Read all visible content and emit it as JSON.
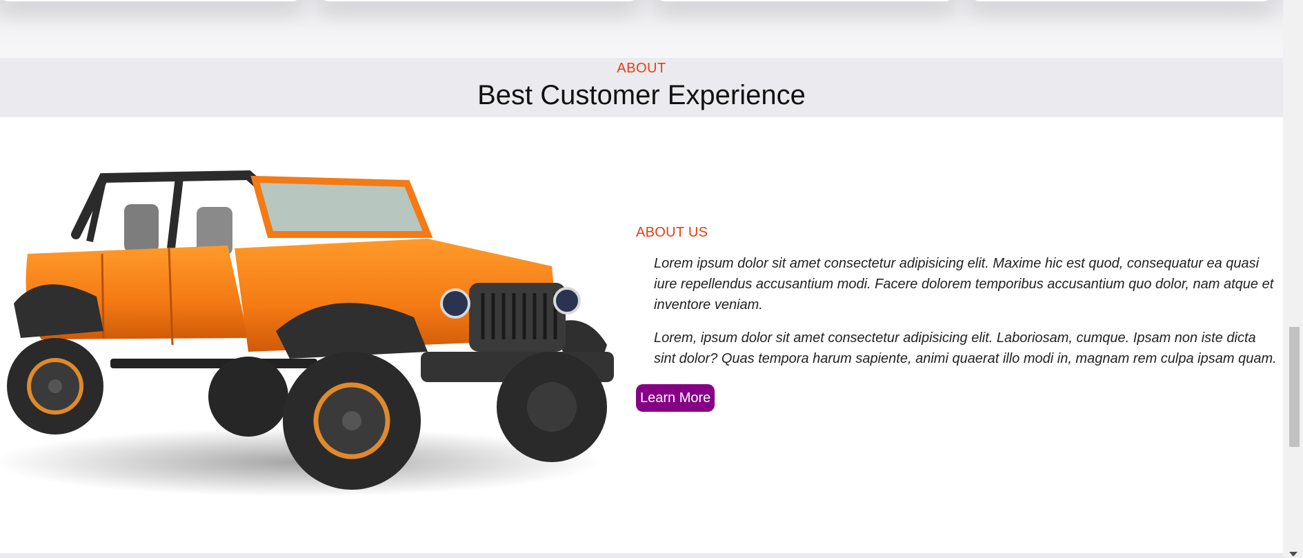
{
  "about_section": {
    "eyebrow": "ABOUT",
    "title": "Best Customer Experience"
  },
  "about_us": {
    "label": "ABOUT US",
    "paragraphs": [
      "Lorem ipsum dolor sit amet consectetur adipisicing elit. Maxime hic est quod, consequatur ea quasi iure repellendus accusantium modi. Facere dolorem temporibus accusantium quo dolor, nam atque et inventore veniam.",
      "Lorem, ipsum dolor sit amet consectetur adipisicing elit. Laboriosam, cumque. Ipsam non iste dicta sint dolor? Quas tempora harum sapiente, animi quaerat illo modi in, magnam rem culpa ipsam quam."
    ],
    "button_label": "Learn More"
  },
  "colors": {
    "accent": "#e63d10",
    "button": "#860086",
    "band": "#ebebef",
    "car_body": "#f47a14"
  },
  "image": {
    "semantic": "orange-jeep-wrangler-image"
  }
}
